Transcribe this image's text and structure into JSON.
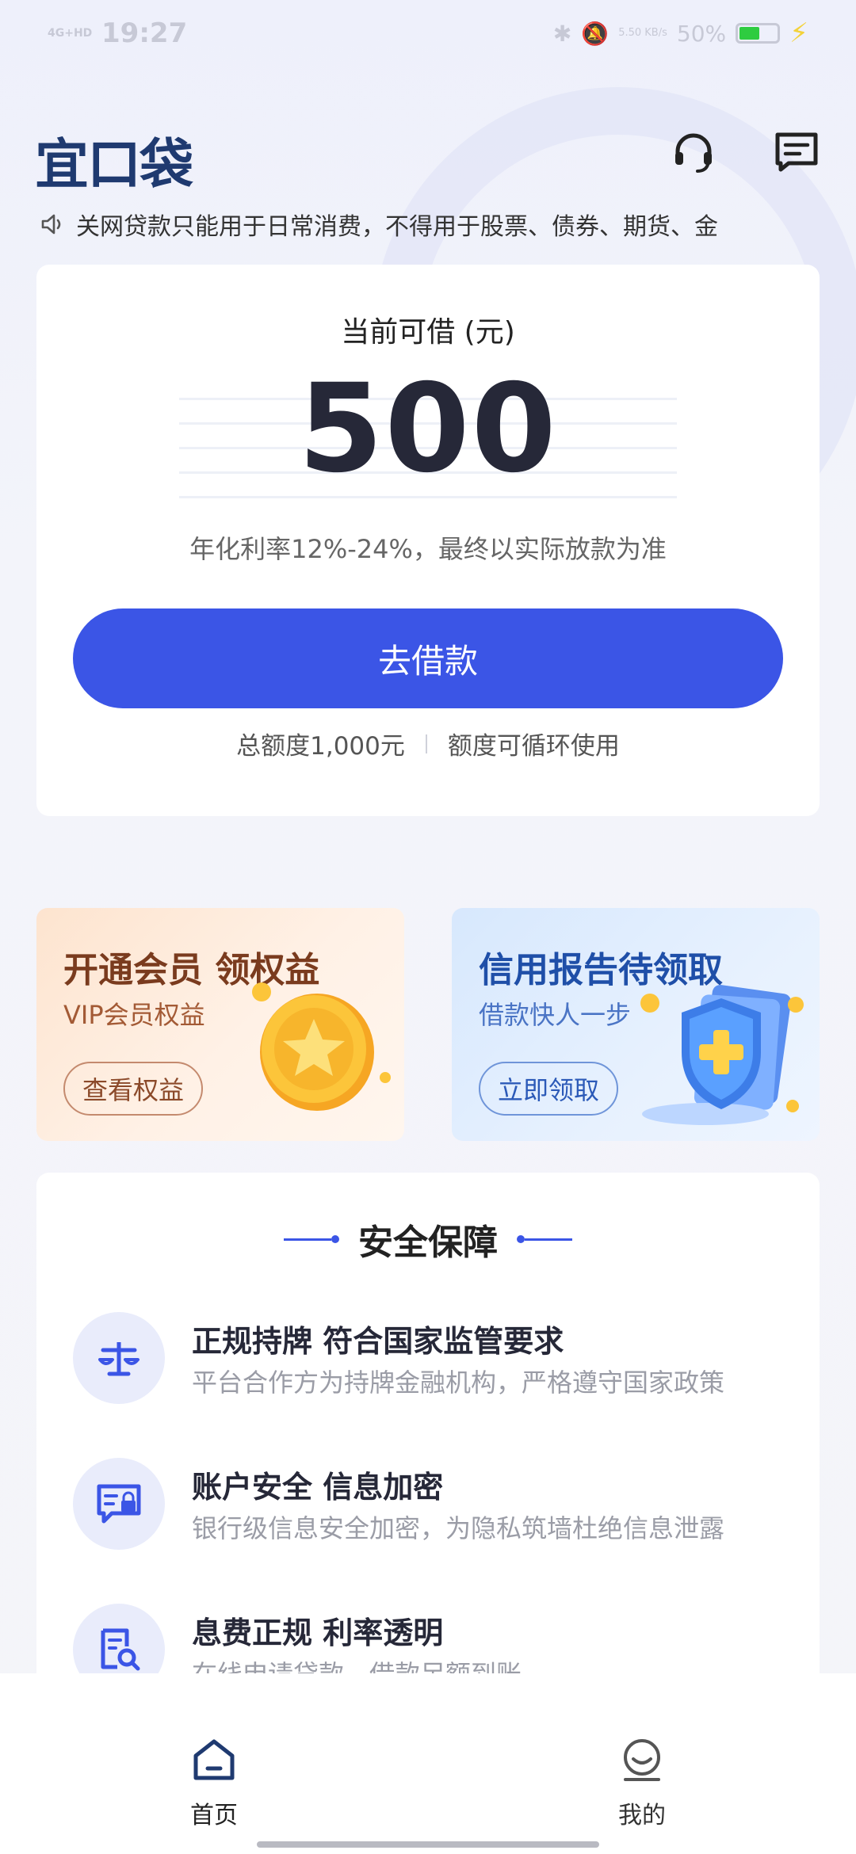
{
  "status_bar": {
    "network": "4G+HD",
    "time": "19:27",
    "speed": "5.50 KB/s",
    "battery": "50%",
    "battery_level": 0.5
  },
  "header": {
    "logo": "宜口袋",
    "icons": [
      "headset-icon",
      "message-icon"
    ]
  },
  "notice": {
    "icon": "speaker-icon",
    "text": "关网贷款只能用于日常消费，不得用于股票、债券、期货、金"
  },
  "loan_card": {
    "label": "当前可借 (元)",
    "amount": "500",
    "rate": "年化利率12%-24%，最终以实际放款为准",
    "button": "去借款",
    "total_limit": "总额度1,000元",
    "revolving": "额度可循环使用"
  },
  "promos": {
    "vip": {
      "title": "开通会员 领权益",
      "subtitle": "VIP会员权益",
      "button": "查看权益"
    },
    "credit": {
      "title": "信用报告待领取",
      "subtitle": "借款快人一步",
      "button": "立即领取"
    }
  },
  "security": {
    "title": "安全保障",
    "items": [
      {
        "heading": "正规持牌 符合国家监管要求",
        "desc": "平台合作方为持牌金融机构，严格遵守国家政策",
        "icon": "scale-icon"
      },
      {
        "heading": "账户安全 信息加密",
        "desc": "银行级信息安全加密，为隐私筑墙杜绝信息泄露",
        "icon": "secure-message-icon"
      },
      {
        "heading": "息费正规  利率透明",
        "desc": "在线申请贷款，借款足额到账",
        "icon": "document-search-icon"
      }
    ]
  },
  "tabbar": {
    "home": "首页",
    "mine": "我的"
  },
  "colors": {
    "primary": "#3b55e6",
    "logo": "#1f3a70"
  }
}
